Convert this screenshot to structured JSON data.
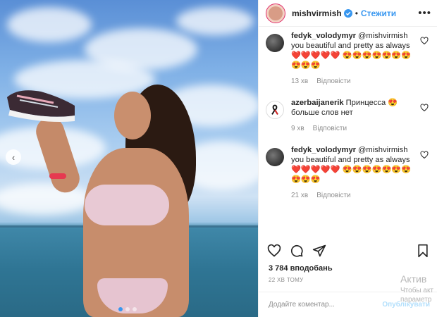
{
  "header": {
    "username": "mishvirmish",
    "separator": "•",
    "follow_label": "Стежити",
    "more_label": "•••"
  },
  "comments": [
    {
      "user": "fedyk_volodymyr",
      "text": "@mishvirmish you beautiful and pretty as always ❤️❤️❤️❤️❤️ 😍😍😍😍😍😍😍😍😍😍",
      "time": "13 хв",
      "reply": "Відповісти"
    },
    {
      "user": "azerbaijanerik",
      "text": "Принцесса 😍 больше слов нет",
      "time": "9 хв",
      "reply": "Відповісти"
    },
    {
      "user": "fedyk_volodymyr",
      "text": "@mishvirmish you beautiful and pretty as always ❤️❤️❤️❤️❤️ 😍😍😍😍😍😍😍😍😍😍",
      "time": "21 хв",
      "reply": "Відповісти"
    }
  ],
  "likes": "3 784 вподобань",
  "timestamp": "22 ХВ ТОМУ",
  "comment_box": {
    "placeholder": "Додайте коментар...",
    "publish_label": "Опублікувати"
  },
  "watermark": {
    "title": "Актив",
    "sub": "Чтобы акт параметр"
  },
  "colors": {
    "accent": "#3897f0",
    "heart": "#ed4956",
    "muted": "#8e8e8e"
  }
}
